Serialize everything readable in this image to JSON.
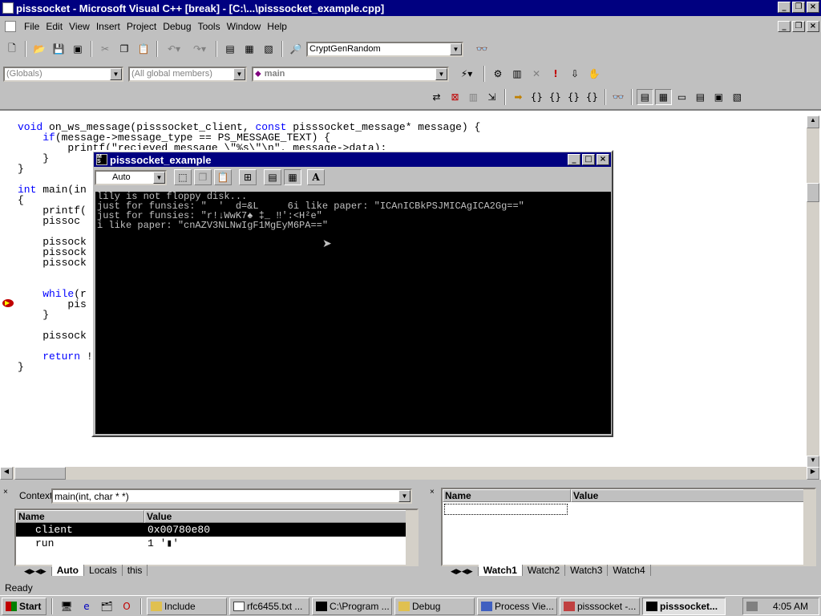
{
  "window": {
    "title": "pisssocket - Microsoft Visual C++ [break] - [C:\\...\\pisssocket_example.cpp]"
  },
  "menu": [
    "File",
    "Edit",
    "View",
    "Insert",
    "Project",
    "Debug",
    "Tools",
    "Window",
    "Help"
  ],
  "toolbar": {
    "find_combo": "CryptGenRandom"
  },
  "wizardbar": {
    "class_combo": "(Globals)",
    "members_combo": "(All global members)",
    "function_combo": "main"
  },
  "code": {
    "line1a": "void",
    "line1b": " on_ws_message(pisssocket_client, ",
    "line1c": "const",
    "line1d": " pisssocket_message* message) {",
    "line2a": "    ",
    "line2b": "if",
    "line2c": "(message->message_type == PS_MESSAGE_TEXT) {",
    "line3": "        printf(\"recieved message \\\"%s\\\"\\n\", message->data);",
    "line4": "    }",
    "line5": "}",
    "line6a": "int",
    "line6b": " main(in",
    "line7": "{",
    "line8": "    printf(",
    "line9": "    pissoc",
    "line10": "    pissock",
    "line11": "    pissock",
    "line12": "    pissock",
    "line13a": "    ",
    "line13b": "while",
    "line13c": "(r",
    "line14": "        pis",
    "line15": "    }",
    "line16": "    pissock",
    "line17a": "    ",
    "line17b": "return",
    "line17c": " !",
    "line18": "}"
  },
  "console": {
    "title": "pisssocket_example",
    "font_combo": "Auto",
    "lines": [
      "lily is not floppy disk...",
      "just for funsies: \"  '  d=&L     6i like paper: \"ICAnICBkPSJMICAgICA2Gg==\"",
      "just for funsies: \"r!↓WwK7♠ ‡_ ‼':<H²e\"",
      "i like paper: \"cnAZV3NLNwIgF1MgEyM6PA==\""
    ]
  },
  "variables": {
    "context_label": "Context:",
    "context_value": "main(int, char * *)",
    "headers": [
      "Name",
      "Value"
    ],
    "rows": [
      {
        "name": "client",
        "value": "0x00780e80"
      },
      {
        "name": "run",
        "value": "1 '▮'"
      }
    ],
    "tabs": [
      "Auto",
      "Locals",
      "this"
    ]
  },
  "watch": {
    "headers": [
      "Name",
      "Value"
    ],
    "tabs": [
      "Watch1",
      "Watch2",
      "Watch3",
      "Watch4"
    ]
  },
  "status": {
    "text": "Ready"
  },
  "taskbar": {
    "start": "Start",
    "tasks": [
      "Include",
      "rfc6455.txt ...",
      "C:\\Program ...",
      "Debug",
      "Process Vie...",
      "pisssocket -...",
      "pisssocket..."
    ],
    "clock": "4:05 AM"
  },
  "colors": {
    "title_bar": "#000080",
    "keyword": "#0000ff",
    "console_bg": "#000000",
    "console_text": "#c0c0c0"
  }
}
